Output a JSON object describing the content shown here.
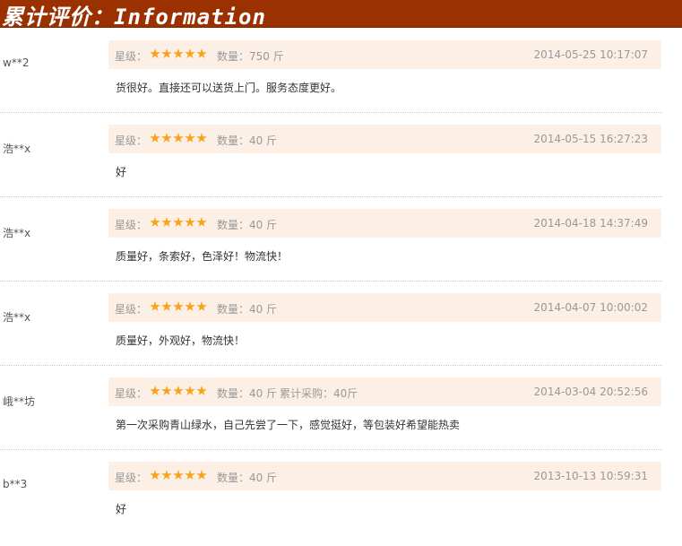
{
  "header": {
    "title": "累计评价：Information"
  },
  "labels": {
    "rating": "星级：",
    "quantity": "数量："
  },
  "reviews": [
    {
      "user": "w**2",
      "quantity": "750 斤",
      "cumulative": "",
      "date": "2014-05-25 10:17:07",
      "content": "货很好。直接还可以送货上门。服务态度更好。",
      "stars": 5
    },
    {
      "user": "浩**x",
      "quantity": "40 斤",
      "cumulative": "",
      "date": "2014-05-15 16:27:23",
      "content": "好",
      "stars": 5
    },
    {
      "user": "浩**x",
      "quantity": "40 斤",
      "cumulative": "",
      "date": "2014-04-18 14:37:49",
      "content": "质量好，条索好，色泽好！物流快！",
      "stars": 5
    },
    {
      "user": "浩**x",
      "quantity": "40 斤",
      "cumulative": "",
      "date": "2014-04-07 10:00:02",
      "content": "质量好，外观好，物流快！",
      "stars": 5
    },
    {
      "user": "峨**坊",
      "quantity": "40 斤",
      "cumulative": "累计采购：40斤",
      "date": "2014-03-04 20:52:56",
      "content": "第一次采购青山绿水，自己先尝了一下，感觉挺好，等包装好希望能热卖",
      "stars": 5
    },
    {
      "user": "b**3",
      "quantity": "40 斤",
      "cumulative": "",
      "date": "2013-10-13 10:59:31",
      "content": "好",
      "stars": 5
    }
  ],
  "colors": {
    "header_bg": "#9b3100",
    "bar_bg": "#fcefe6",
    "star": "#f7a21a"
  }
}
